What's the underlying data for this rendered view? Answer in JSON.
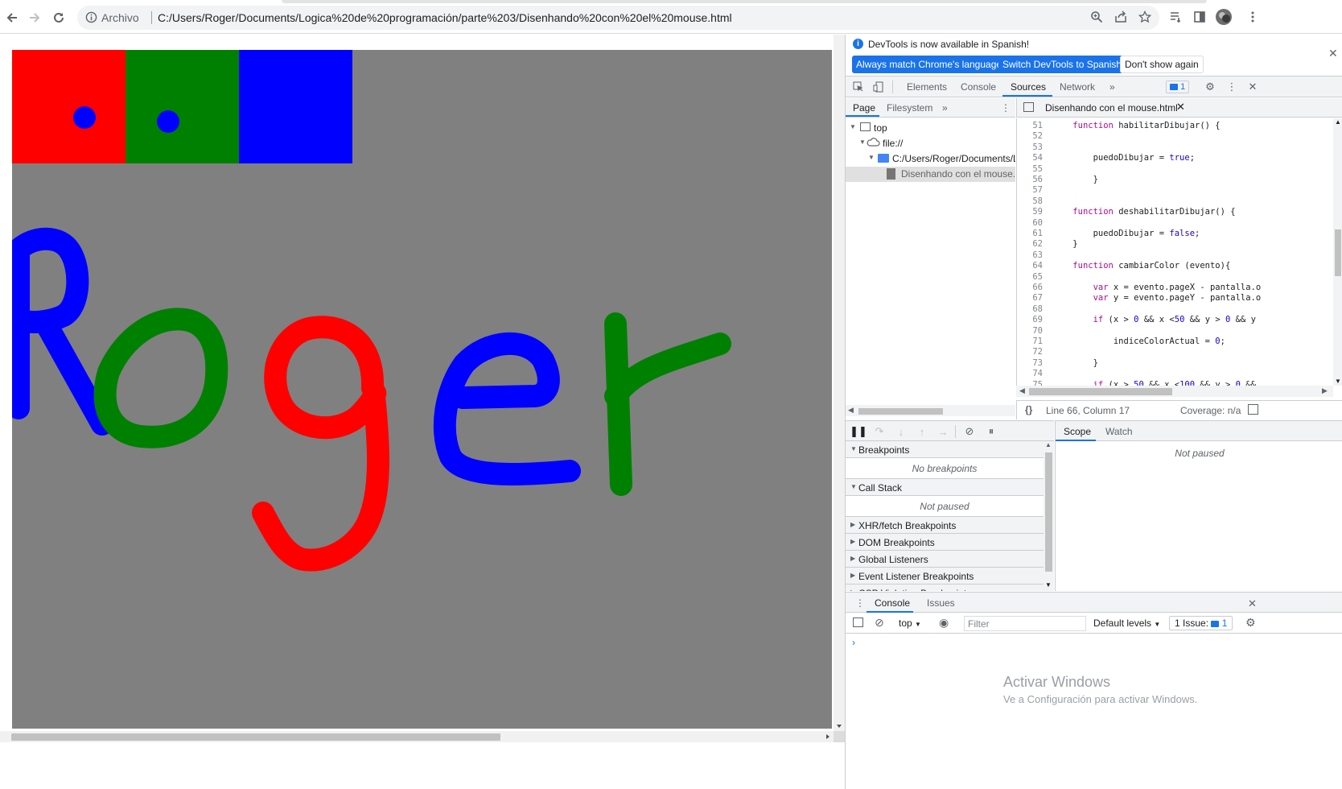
{
  "browser": {
    "scheme_label": "Archivo",
    "url": "C:/Users/Roger/Documents/Logica%20de%20programación/parte%203/Disenhando%20con%20el%20mouse.html"
  },
  "canvas": {
    "background": "#808080",
    "palette": [
      {
        "color": "#ff0000",
        "name": "red"
      },
      {
        "color": "#008000",
        "name": "green"
      },
      {
        "color": "#0000ff",
        "name": "blue"
      }
    ],
    "drawn_text": "Roger"
  },
  "devtools": {
    "info_message": "DevTools is now available in Spanish!",
    "btn_match_language": "Always match Chrome's language",
    "btn_switch_spanish": "Switch DevTools to Spanish",
    "btn_dont_show": "Don't show again",
    "tabs": [
      "Elements",
      "Console",
      "Sources",
      "Network"
    ],
    "active_tab": "Sources",
    "issues_count": "1",
    "navigator": {
      "tabs": [
        "Page",
        "Filesystem"
      ],
      "tree": [
        "top",
        "file://",
        "C:/Users/Roger/Documents/Lo",
        "Disenhando con el mouse.ht"
      ]
    },
    "editor": {
      "file_tab": "Disenhando con el mouse.html",
      "lines": [
        {
          "n": "51",
          "code": "    function habilitarDibujar() {"
        },
        {
          "n": "52",
          "code": ""
        },
        {
          "n": "53",
          "code": ""
        },
        {
          "n": "54",
          "code": "        puedoDibujar = true;"
        },
        {
          "n": "55",
          "code": ""
        },
        {
          "n": "56",
          "code": "        }"
        },
        {
          "n": "57",
          "code": ""
        },
        {
          "n": "58",
          "code": ""
        },
        {
          "n": "59",
          "code": "    function deshabilitarDibujar() {"
        },
        {
          "n": "60",
          "code": ""
        },
        {
          "n": "61",
          "code": "        puedoDibujar = false;"
        },
        {
          "n": "62",
          "code": "    }"
        },
        {
          "n": "63",
          "code": ""
        },
        {
          "n": "64",
          "code": "    function cambiarColor (evento){"
        },
        {
          "n": "65",
          "code": ""
        },
        {
          "n": "66",
          "code": "        var x = evento.pageX - pantalla.o"
        },
        {
          "n": "67",
          "code": "        var y = evento.pageY - pantalla.o"
        },
        {
          "n": "68",
          "code": ""
        },
        {
          "n": "69",
          "code": "        if (x > 0 && x <50 && y > 0 && y"
        },
        {
          "n": "70",
          "code": ""
        },
        {
          "n": "71",
          "code": "            indiceColorActual = 0;"
        },
        {
          "n": "72",
          "code": ""
        },
        {
          "n": "73",
          "code": "        }"
        },
        {
          "n": "74",
          "code": ""
        },
        {
          "n": "75",
          "code": "        if (x > 50 && x <100 && y > 0 &&"
        }
      ],
      "status_position": "Line 66, Column 17",
      "status_coverage": "Coverage: n/a"
    },
    "debugger": {
      "sections": [
        {
          "label": "Breakpoints",
          "body": "No breakpoints",
          "open": true
        },
        {
          "label": "Call Stack",
          "body": "Not paused",
          "open": true
        },
        {
          "label": "XHR/fetch Breakpoints",
          "open": false
        },
        {
          "label": "DOM Breakpoints",
          "open": false
        },
        {
          "label": "Global Listeners",
          "open": false
        },
        {
          "label": "Event Listener Breakpoints",
          "open": false
        },
        {
          "label": "CSP Violation Breakpoints",
          "open": false
        }
      ],
      "scope_tabs": [
        "Scope",
        "Watch"
      ],
      "scope_body": "Not paused"
    },
    "drawer": {
      "tabs": [
        "Console",
        "Issues"
      ],
      "context": "top",
      "filter_placeholder": "Filter",
      "levels": "Default levels",
      "issues_label": "1 Issue:",
      "issues_count": "1"
    }
  },
  "windows_watermark": {
    "title": "Activar Windows",
    "subtitle": "Ve a Configuración para activar Windows."
  }
}
